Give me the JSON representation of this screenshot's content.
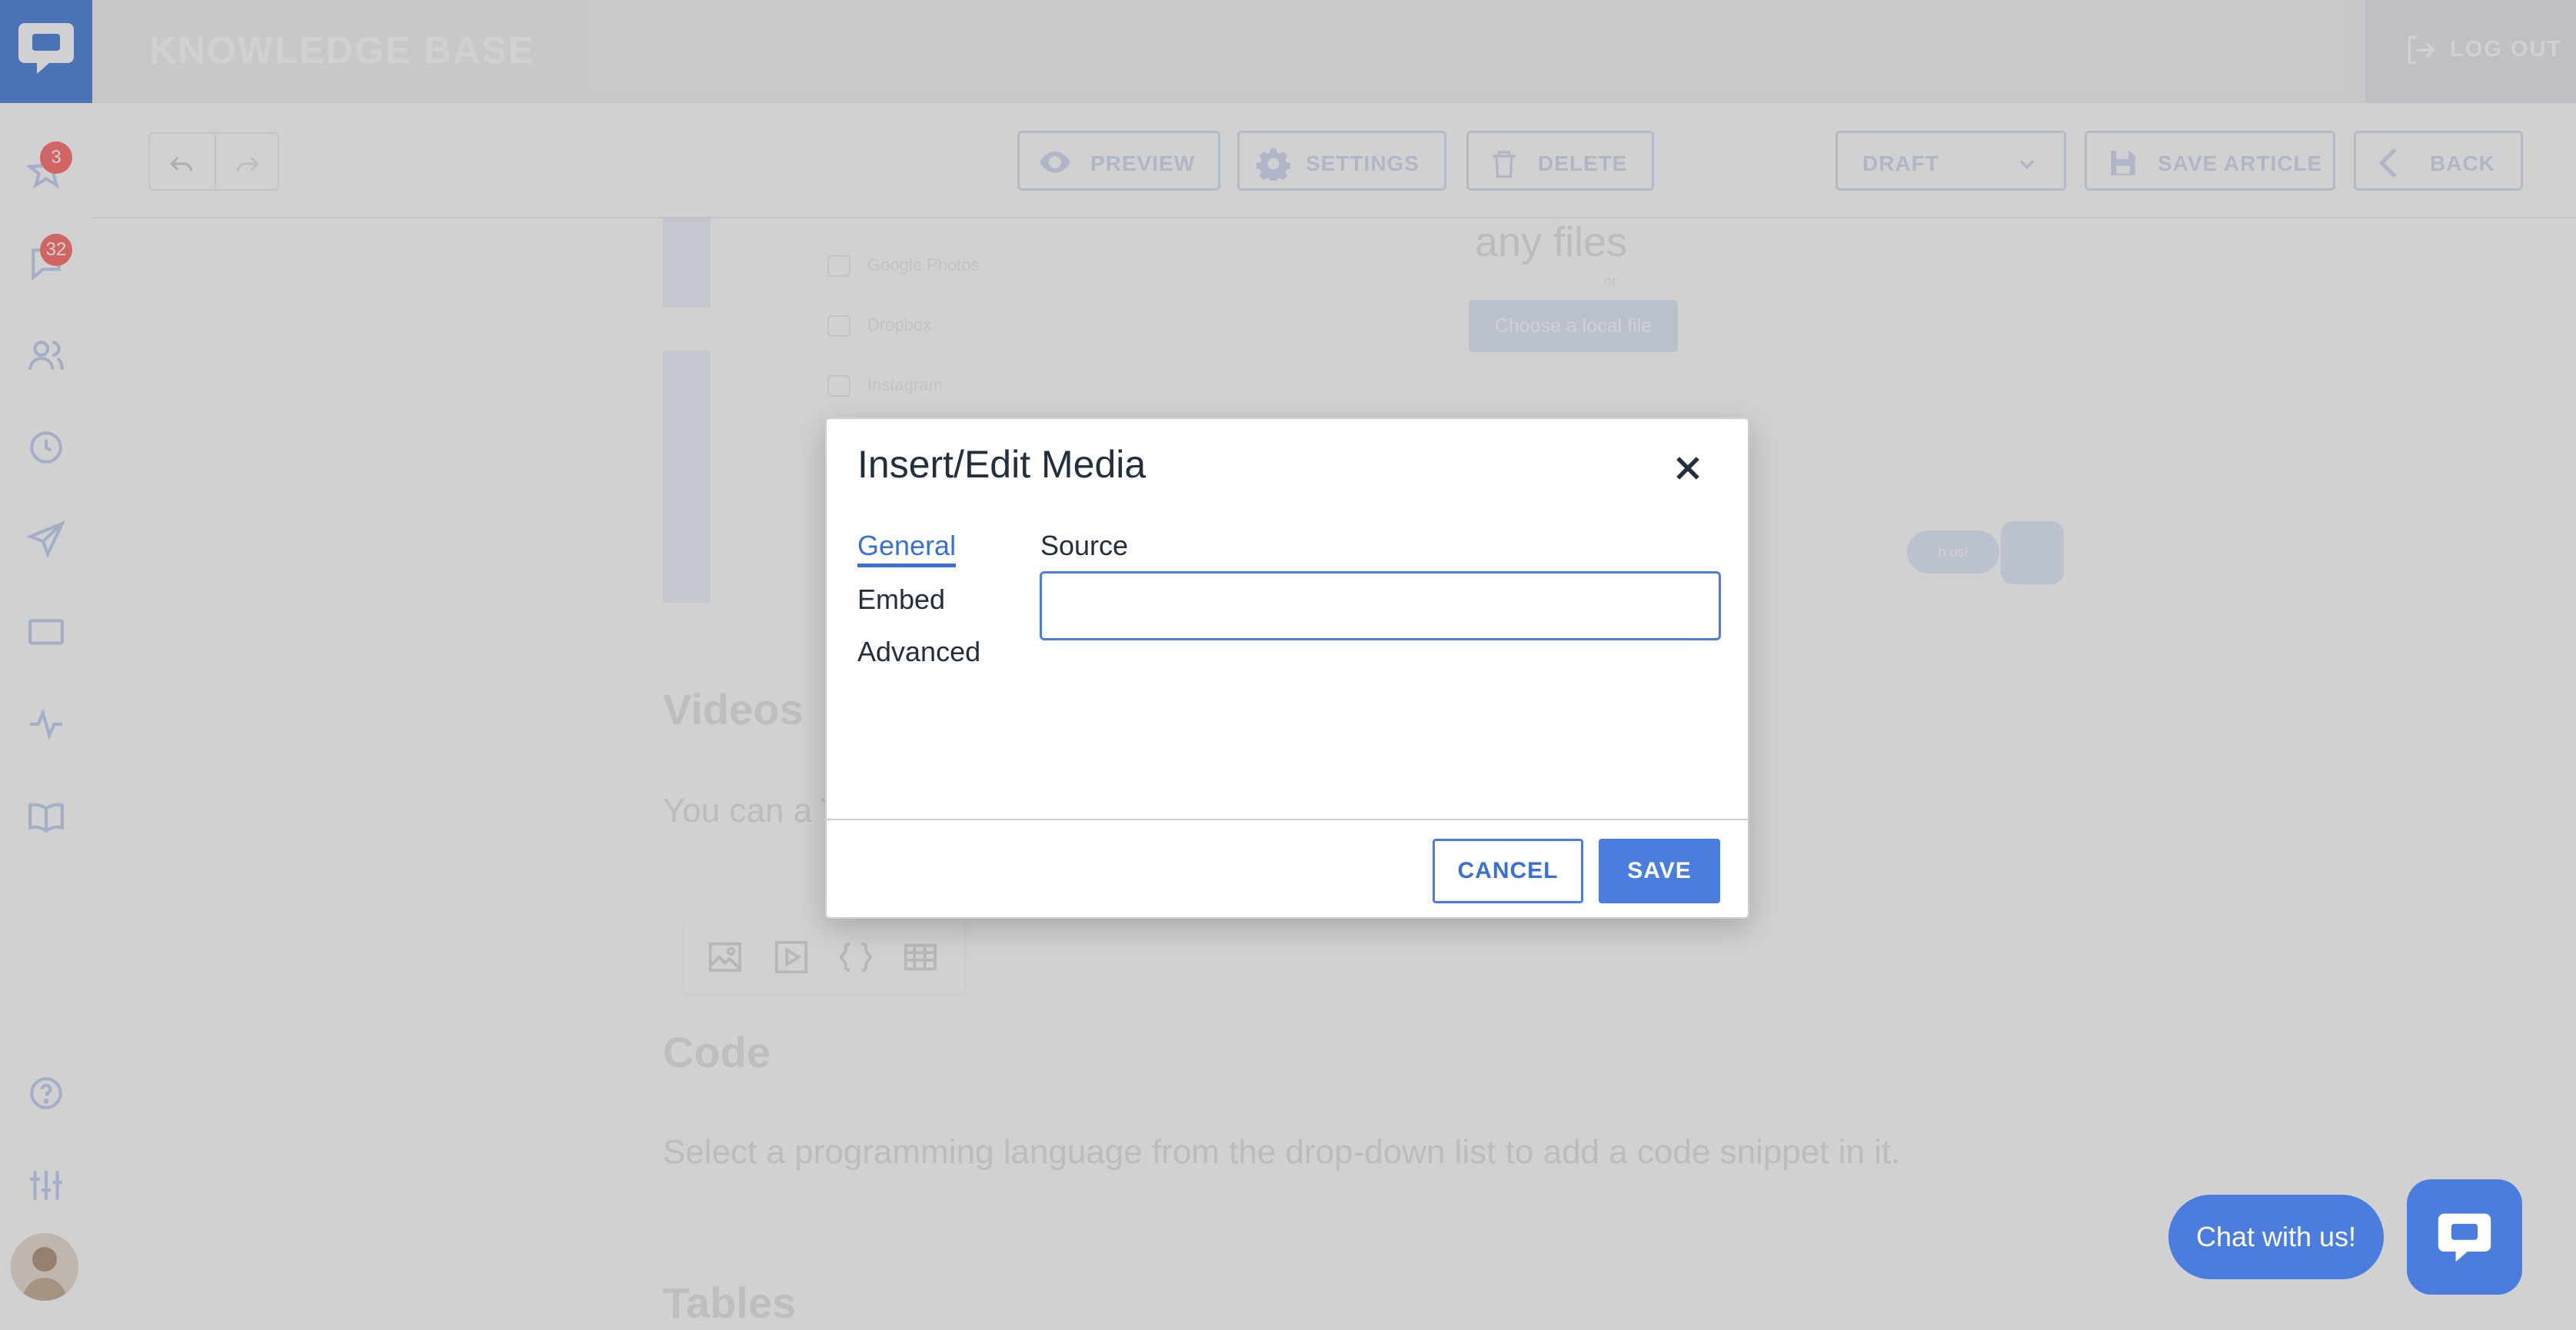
{
  "app": {
    "title": "KNOWLEDGE BASE",
    "logout_label": "LOG OUT",
    "logo_icon": "chat-bubble-icon"
  },
  "sidebar": {
    "items": [
      {
        "icon": "star-icon",
        "badge": "3"
      },
      {
        "icon": "chat-icon",
        "badge": "32"
      },
      {
        "icon": "users-icon"
      },
      {
        "icon": "clock-icon"
      },
      {
        "icon": "send-icon"
      },
      {
        "icon": "window-icon"
      },
      {
        "icon": "activity-icon"
      },
      {
        "icon": "book-icon"
      },
      {
        "icon": "help-icon"
      },
      {
        "icon": "sliders-icon"
      }
    ]
  },
  "toolbar": {
    "preview": "PREVIEW",
    "settings": "SETTINGS",
    "delete": "DELETE",
    "status": "DRAFT",
    "save_article": "SAVE ARTICLE",
    "back": "BACK"
  },
  "content": {
    "image": {
      "items": [
        "Google Photos",
        "Dropbox",
        "Instagram"
      ],
      "headline": "any files",
      "or": "or",
      "choose_button": "Choose a local file",
      "chat_pill": "h us!"
    },
    "videos_heading": "Videos",
    "videos_text": "You can a                                                                         Tube and Vimeo.",
    "code_heading": "Code",
    "code_text": "Select a programming language from the drop-down list to add a code snippet in it.",
    "tables_heading": "Tables"
  },
  "dialog": {
    "title": "Insert/Edit Media",
    "tabs": [
      "General",
      "Embed",
      "Advanced"
    ],
    "active_tab": "General",
    "source_label": "Source",
    "source_value": "",
    "cancel": "CANCEL",
    "save": "SAVE"
  },
  "chat": {
    "label": "Chat with us!"
  },
  "colors": {
    "accent": "#4a7ddd",
    "text": "#222f3e",
    "badge": "#ff7c7c"
  }
}
